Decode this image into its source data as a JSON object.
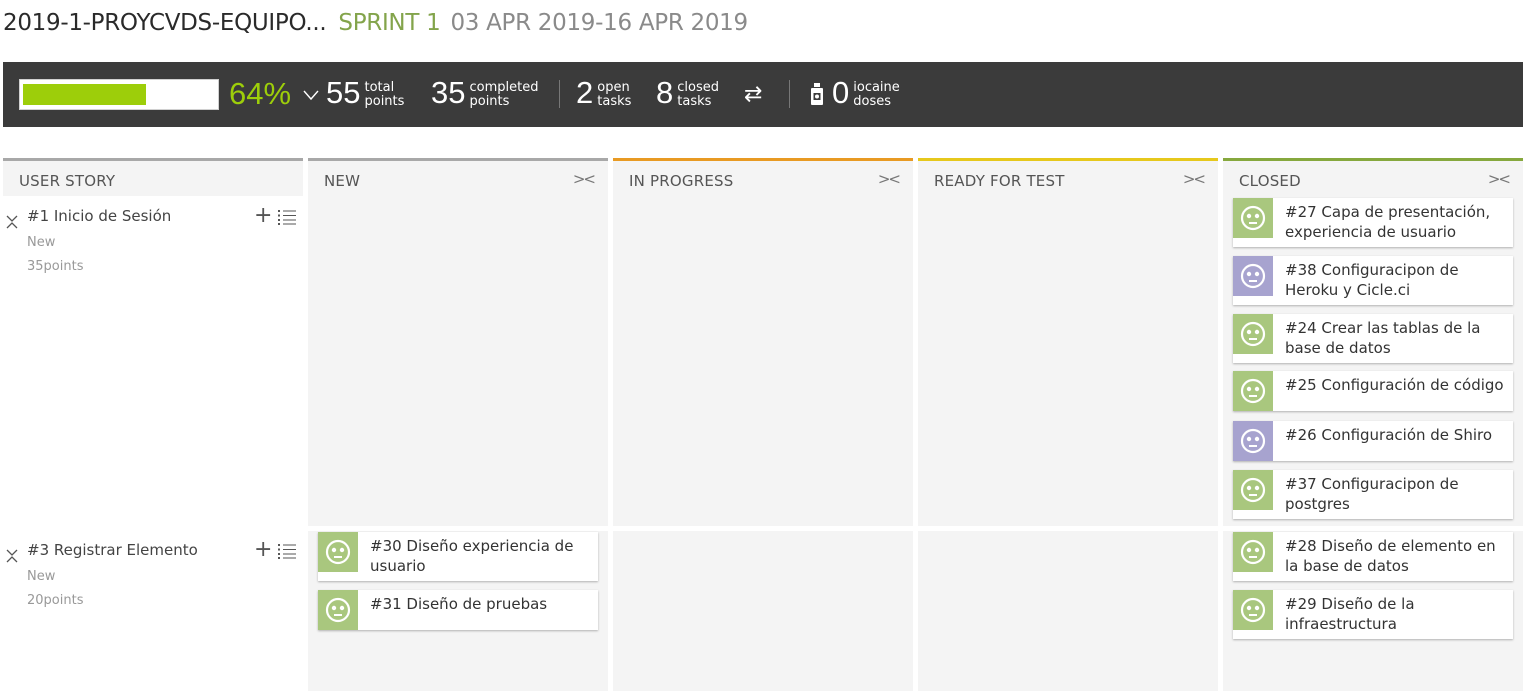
{
  "header": {
    "project_name": "2019-1-PROYCVDS-EQUIPO...",
    "sprint_label": "SPRINT 1",
    "sprint_dates": "03 APR 2019-16 APR 2019"
  },
  "summary": {
    "progress_percent": 64,
    "percent_text": "64%",
    "total_points": "55",
    "total_label_1": "total",
    "total_label_2": "points",
    "completed_points": "35",
    "completed_label_1": "completed",
    "completed_label_2": "points",
    "open_tasks": "2",
    "open_label_1": "open",
    "open_label_2": "tasks",
    "closed_tasks": "8",
    "closed_label_1": "closed",
    "closed_label_2": "tasks",
    "iocaine_doses": "0",
    "iocaine_label_1": "iocaine",
    "iocaine_label_2": "doses",
    "fill_color": "#9dce0a"
  },
  "columns": {
    "user_story": "USER STORY",
    "new": "NEW",
    "in_progress": "IN PROGRESS",
    "ready_for_test": "READY FOR TEST",
    "closed": "CLOSED",
    "fold_icon": "collapse-arrows-icon",
    "colors": {
      "user_story": "#a8a8a8",
      "new": "#a8a8a8",
      "in_progress": "#e89a23",
      "ready_for_test": "#e6c81c",
      "closed": "#86a83d"
    }
  },
  "stories": [
    {
      "title": "#1 Inicio de Sesión",
      "status": "New",
      "points": "35points",
      "closed_tasks": [
        {
          "title": "#27 Capa de presentación, experiencia de usuario",
          "avatar": "green"
        },
        {
          "title": "#38 Configuracipon de Heroku y Cicle.ci",
          "avatar": "purple"
        },
        {
          "title": "#24 Crear las tablas de la base de datos",
          "avatar": "green"
        },
        {
          "title": "#25 Configuración de código",
          "avatar": "green"
        },
        {
          "title": "#26 Configuración de Shiro",
          "avatar": "purple"
        },
        {
          "title": "#37 Configuracipon de postgres",
          "avatar": "green"
        }
      ]
    },
    {
      "title": "#3 Registrar Elemento",
      "status": "New",
      "points": "20points",
      "new_tasks": [
        {
          "title": "#30 Diseño experiencia de usuario",
          "avatar": "green"
        },
        {
          "title": "#31 Diseño de pruebas",
          "avatar": "green"
        }
      ],
      "closed_tasks": [
        {
          "title": "#28 Diseño de elemento en la base de datos",
          "avatar": "green"
        },
        {
          "title": "#29 Diseño de la infraestructura",
          "avatar": "green"
        }
      ]
    }
  ],
  "avatar_colors": {
    "green": "#a9c77e",
    "purple": "#a7a3cf"
  }
}
